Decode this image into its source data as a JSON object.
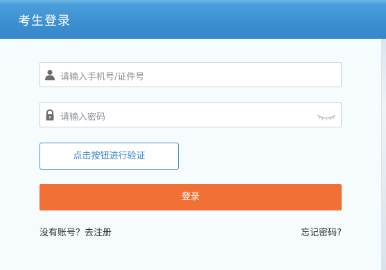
{
  "header": {
    "title": "考生登录"
  },
  "form": {
    "phone_placeholder": "请输入手机号/证件号",
    "password_placeholder": "请输入密码",
    "phone_icon": "user-icon",
    "password_icon": "lock-icon",
    "password_toggle_icon": "closed-eye-icon",
    "verify_button_label": "点击按钮进行验证",
    "login_button_label": "登录"
  },
  "footer": {
    "register_text": "没有账号？去注册",
    "forgot_text": "忘记密码?"
  },
  "colors": {
    "header_blue": "#3c8fd0",
    "login_orange": "#f07036",
    "verify_border": "#3c8fd0"
  }
}
